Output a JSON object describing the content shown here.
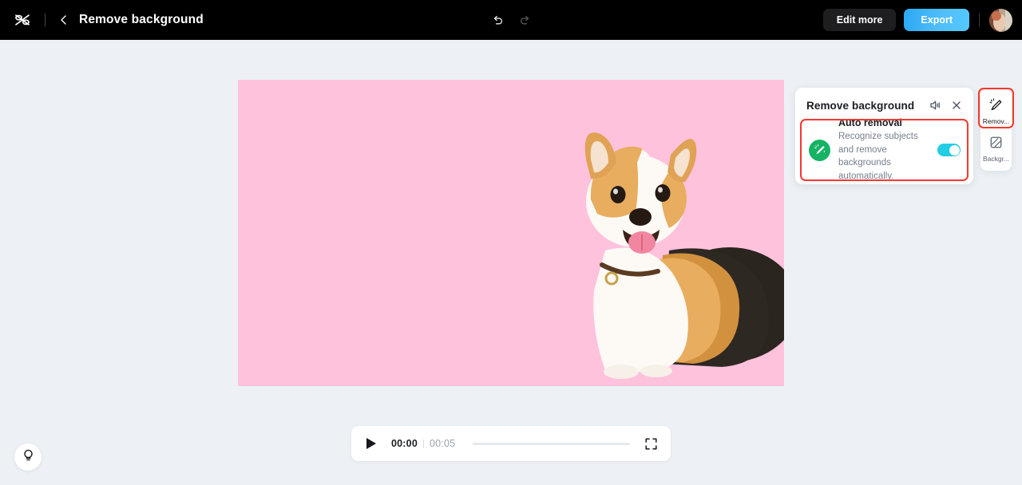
{
  "app": {
    "name": "CapCut",
    "logo_icon": "capcut-logo-icon",
    "background_color": "#edf1f5"
  },
  "topbar": {
    "background_color": "#000000",
    "back_icon": "chevron-left-icon",
    "title": "Remove background",
    "undo_icon": "undo-icon",
    "redo_icon": "redo-icon",
    "edit_more_label": "Edit more",
    "export_label": "Export",
    "export_color": "#3fb5fa",
    "avatar_icon": "user-avatar"
  },
  "canvas": {
    "background_color": "#ffc2dc",
    "subject": "corgi-dog",
    "subject_description": "Tricolor Pembroke Welsh Corgi sitting, tongue out, wearing a brown collar"
  },
  "playbar": {
    "play_icon": "play-icon",
    "current_time": "00:00",
    "duration": "00:05",
    "progress_percent": 0,
    "fullscreen_icon": "fullscreen-icon"
  },
  "help": {
    "icon": "lightbulb-icon"
  },
  "panel": {
    "title": "Remove background",
    "audio_icon": "speaker-icon",
    "close_icon": "close-icon",
    "card": {
      "icon": "magic-wand-icon",
      "icon_color": "#16b364",
      "title": "Auto removal",
      "description": "Recognize subjects and remove backgrounds automatically.",
      "toggle_on": true,
      "toggle_color": "#22cce2"
    },
    "highlight_color": "#f4392f"
  },
  "sidebar": {
    "items": [
      {
        "icon": "magic-wand-icon",
        "label": "Remov...",
        "active": true
      },
      {
        "icon": "background-hatch-icon",
        "label": "Backgr...",
        "active": false
      }
    ]
  }
}
